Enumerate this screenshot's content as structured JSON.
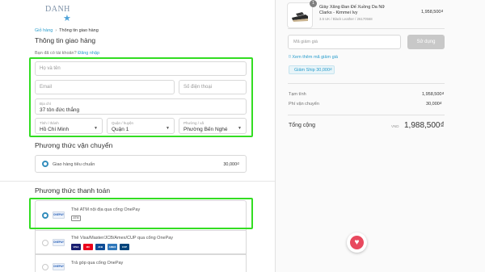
{
  "brand": {
    "name": "DANH"
  },
  "breadcrumb": {
    "cart": "Giỏ hàng",
    "current": "Thông tin giao hàng"
  },
  "shipping_info": {
    "title": "Thông tin giao hàng",
    "account_prompt": "Bạn đã có tài khoản?",
    "login_link": "Đăng nhập",
    "fullname_placeholder": "Họ và tên",
    "email_placeholder": "Email",
    "phone_placeholder": "Số điện thoại",
    "address_label": "Địa chỉ",
    "address_value": "37 tôn đức thắng",
    "province_label": "Tỉnh / thành",
    "province_value": "Hồ Chí Minh",
    "district_label": "Quận / huyện",
    "district_value": "Quận 1",
    "ward_label": "Phường / xã",
    "ward_value": "Phường Bến Nghé"
  },
  "shipping_method": {
    "title": "Phương thức vận chuyển",
    "option_label": "Giao hàng tiêu chuẩn",
    "option_price": "30,000₫"
  },
  "payment_method": {
    "title": "Phương thức thanh toán",
    "options": [
      {
        "label": "Thẻ ATM nội địa qua cổng OnePay",
        "logo": "ONEPAY",
        "sub_icon": "ATM"
      },
      {
        "label": "Thẻ Visa/Master/JCB/Amex/CUP qua cổng OnePay",
        "logo": "ONEPAY",
        "cards": [
          "VISA",
          "MC",
          "JCB",
          "AMEX",
          "CUP"
        ]
      },
      {
        "label": "Trả góp qua cổng OnePay",
        "logo": "ONEPAY"
      }
    ]
  },
  "order": {
    "quantity_badge": "1",
    "product_name_line1": "Giày Xăng Đan Đế Xuồng Da Nữ",
    "product_name_line2": "Clarks - Kimmei Ivy",
    "product_variant": "3.5 UK / Black Leather / 26170568",
    "product_price": "1,958,500₫",
    "coupon_placeholder": "Mã giảm giá",
    "apply_button": "Sử dụng",
    "more_coupons": "Xem thêm mã giảm giá",
    "coupon_tag": "Giảm Ship 30,000₫",
    "subtotal_label": "Tạm tính",
    "subtotal_value": "1,958,500₫",
    "shipping_fee_label": "Phí vận chuyển",
    "shipping_fee_value": "30,000₫",
    "total_label": "Tổng cộng",
    "currency": "VND",
    "total_value": "1,988,500₫"
  },
  "colors": {
    "accent": "#2a9dcc",
    "highlight": "#33dd22",
    "heart": "#e8495e"
  },
  "icons": [
    "star-logo-icon",
    "tag-icon",
    "chevron-down-icon",
    "heart-icon",
    "radio-icon"
  ]
}
